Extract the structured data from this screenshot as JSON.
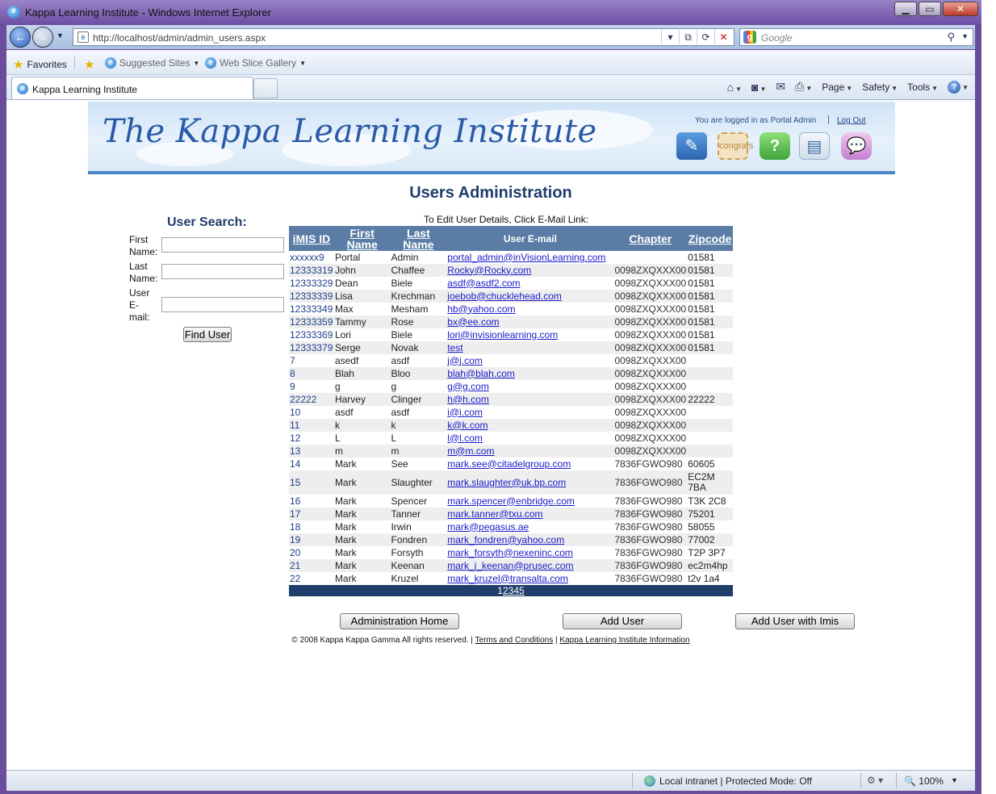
{
  "browser": {
    "window_title": "Kappa Learning Institute - Windows Internet Explorer",
    "url": "http://localhost/admin/admin_users.aspx",
    "search_placeholder": "Google",
    "favorites_label": "Favorites",
    "suggested_sites": "Suggested Sites",
    "web_slice_gallery": "Web Slice Gallery",
    "tab_title": "Kappa Learning Institute",
    "cmd": {
      "page": "Page",
      "safety": "Safety",
      "tools": "Tools"
    },
    "status": {
      "zone": "Local intranet | Protected Mode: Off",
      "zoom": "100%"
    }
  },
  "banner": {
    "logo": "The Kappa Learning Institute",
    "login_text": "You are logged in as Portal Admin",
    "logout": "Log Out",
    "congrats_icon_text": "congrats"
  },
  "page_title": "Users Administration",
  "search": {
    "title": "User Search:",
    "first_name_label": "First Name:",
    "last_name_label": "Last Name:",
    "email_label": "User E-mail:",
    "find_button": "Find User"
  },
  "table": {
    "hint": "To Edit User Details, Click E-Mail Link:",
    "headers": {
      "imis": "iMIS ID",
      "first": "First Name",
      "last": "Last Name",
      "email": "User E-mail",
      "chapter": "Chapter",
      "zip": "Zipcode"
    },
    "rows": [
      {
        "id": "xxxxxx9",
        "first": "Portal",
        "last": "Admin",
        "email": "portal_admin@inVisionLearning.com",
        "chapter": "",
        "zip": "01581"
      },
      {
        "id": "12333319",
        "first": "John",
        "last": "Chaffee",
        "email": "Rocky@Rocky.com",
        "chapter": "0098ZXQXXX00",
        "zip": "01581"
      },
      {
        "id": "12333329",
        "first": "Dean",
        "last": "Biele",
        "email": "asdf@asdf2.com",
        "chapter": "0098ZXQXXX00",
        "zip": "01581"
      },
      {
        "id": "12333339",
        "first": "Lisa",
        "last": "Krechman",
        "email": "joebob@chucklehead.com",
        "chapter": "0098ZXQXXX00",
        "zip": "01581"
      },
      {
        "id": "12333349",
        "first": "Max",
        "last": "Mesham",
        "email": "hb@yahoo.com",
        "chapter": "0098ZXQXXX00",
        "zip": "01581"
      },
      {
        "id": "12333359",
        "first": "Tammy",
        "last": "Rose",
        "email": "bx@ee.com",
        "chapter": "0098ZXQXXX00",
        "zip": "01581"
      },
      {
        "id": "12333369",
        "first": "Lori",
        "last": "Biele",
        "email": "lori@invisionlearning.com",
        "chapter": "0098ZXQXXX00",
        "zip": "01581"
      },
      {
        "id": "12333379",
        "first": "Serge",
        "last": "Novak",
        "email": "test",
        "chapter": "0098ZXQXXX00",
        "zip": "01581"
      },
      {
        "id": "7",
        "first": "asedf",
        "last": "asdf",
        "email": "j@j.com",
        "chapter": "0098ZXQXXX00",
        "zip": ""
      },
      {
        "id": "8",
        "first": "Blah",
        "last": "Bloo",
        "email": "blah@blah.com",
        "chapter": "0098ZXQXXX00",
        "zip": ""
      },
      {
        "id": "9",
        "first": "g",
        "last": "g",
        "email": "g@g.com",
        "chapter": "0098ZXQXXX00",
        "zip": ""
      },
      {
        "id": "22222",
        "first": "Harvey",
        "last": "Clinger",
        "email": "h@h.com",
        "chapter": "0098ZXQXXX00",
        "zip": "22222"
      },
      {
        "id": "10",
        "first": "asdf",
        "last": "asdf",
        "email": "i@i.com",
        "chapter": "0098ZXQXXX00",
        "zip": ""
      },
      {
        "id": "11",
        "first": "k",
        "last": "k",
        "email": "k@k.com",
        "chapter": "0098ZXQXXX00",
        "zip": ""
      },
      {
        "id": "12",
        "first": "L",
        "last": "L",
        "email": "l@l.com",
        "chapter": "0098ZXQXXX00",
        "zip": ""
      },
      {
        "id": "13",
        "first": "m",
        "last": "m",
        "email": "m@m.com",
        "chapter": "0098ZXQXXX00",
        "zip": ""
      },
      {
        "id": "14",
        "first": "Mark",
        "last": "See",
        "email": "mark.see@citadelgroup.com",
        "chapter": "7836FGWO980",
        "zip": "60605"
      },
      {
        "id": "15",
        "first": "Mark",
        "last": "Slaughter",
        "email": "mark.slaughter@uk.bp.com",
        "chapter": "7836FGWO980",
        "zip": "EC2M 7BA"
      },
      {
        "id": "16",
        "first": "Mark",
        "last": "Spencer",
        "email": "mark.spencer@enbridge.com",
        "chapter": "7836FGWO980",
        "zip": "T3K 2C8"
      },
      {
        "id": "17",
        "first": "Mark",
        "last": "Tanner",
        "email": "mark.tanner@txu.com",
        "chapter": "7836FGWO980",
        "zip": "75201"
      },
      {
        "id": "18",
        "first": "Mark",
        "last": "Irwin",
        "email": "mark@pegasus.ae",
        "chapter": "7836FGWO980",
        "zip": "58055"
      },
      {
        "id": "19",
        "first": "Mark",
        "last": "Fondren",
        "email": "mark_fondren@yahoo.com",
        "chapter": "7836FGWO980",
        "zip": "77002"
      },
      {
        "id": "20",
        "first": "Mark",
        "last": "Forsyth",
        "email": "mark_forsyth@nexeninc.com",
        "chapter": "7836FGWO980",
        "zip": "T2P 3P7"
      },
      {
        "id": "21",
        "first": "Mark",
        "last": "Keenan",
        "email": "mark_j_keenan@prusec.com",
        "chapter": "7836FGWO980",
        "zip": "ec2m4hp"
      },
      {
        "id": "22",
        "first": "Mark",
        "last": "Kruzel",
        "email": "mark_kruzel@transalta.com",
        "chapter": "7836FGWO980",
        "zip": "t2v 1a4"
      }
    ],
    "pager": {
      "current": "1",
      "pages": [
        "2",
        "3",
        "4",
        "5"
      ]
    }
  },
  "buttons": {
    "admin_home": "Administration Home",
    "add_user": "Add User",
    "add_user_imis": "Add User with Imis"
  },
  "footer": {
    "copyright": "© 2008 Kappa Kappa Gamma All rights reserved. |",
    "terms": "Terms and Conditions",
    "sep": "|",
    "info": "Kappa Learning Institute Information"
  }
}
